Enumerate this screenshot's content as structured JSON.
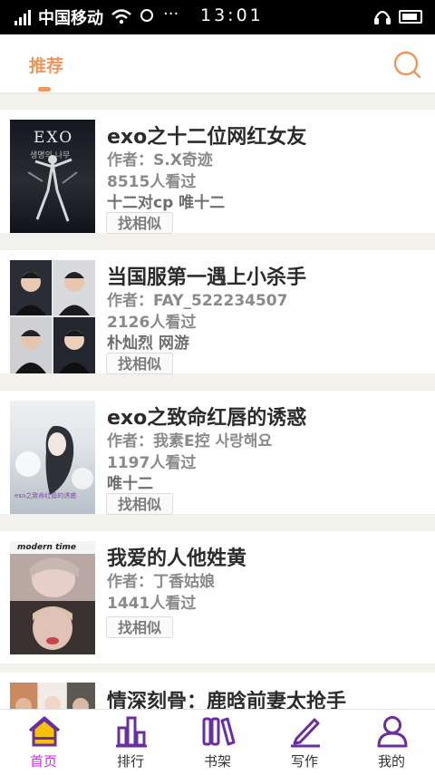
{
  "status_bar": {
    "carrier": "中国移动",
    "time": "13:01",
    "dots": "···"
  },
  "header": {
    "tab_label": "推荐",
    "search_icon": "search-icon"
  },
  "books": [
    {
      "title": "exo之十二位网红女友",
      "author": "作者：S.X奇迹",
      "views": "8515人看过",
      "tags": "十二对cp 唯十二",
      "similar_label": "找相似",
      "cover_text": "EXO",
      "cover_subtext": "생명의 나무"
    },
    {
      "title": "当国服第一遇上小杀手",
      "author": "作者：FAY_522234507",
      "views": "2126人看过",
      "tags": "朴灿烈 网游",
      "similar_label": "找相似"
    },
    {
      "title": "exo之致命红唇的诱惑",
      "author": "作者：我素E控 사랑해요",
      "views": "1197人看过",
      "tags": "唯十二",
      "similar_label": "找相似",
      "cover_text": "exo之致命红唇的诱惑"
    },
    {
      "title": "我爱的人他姓黄",
      "author": "作者：丁香姑娘",
      "views": "1441人看过",
      "tags": "",
      "similar_label": "找相似",
      "cover_text": "modern time"
    },
    {
      "title": "情深刻骨：鹿晗前妻太抢手",
      "author": "",
      "views": "",
      "tags": "",
      "similar_label": ""
    }
  ],
  "nav": [
    {
      "label": "首页",
      "icon": "home-icon",
      "active": true
    },
    {
      "label": "排行",
      "icon": "ranking-icon",
      "active": false
    },
    {
      "label": "书架",
      "icon": "bookshelf-icon",
      "active": false
    },
    {
      "label": "写作",
      "icon": "pen-icon",
      "active": false
    },
    {
      "label": "我的",
      "icon": "person-icon",
      "active": false
    }
  ],
  "colors": {
    "accent": "#f0965a",
    "nav_active": "#c72ee8",
    "nav_icon": "#6a2ea3"
  }
}
